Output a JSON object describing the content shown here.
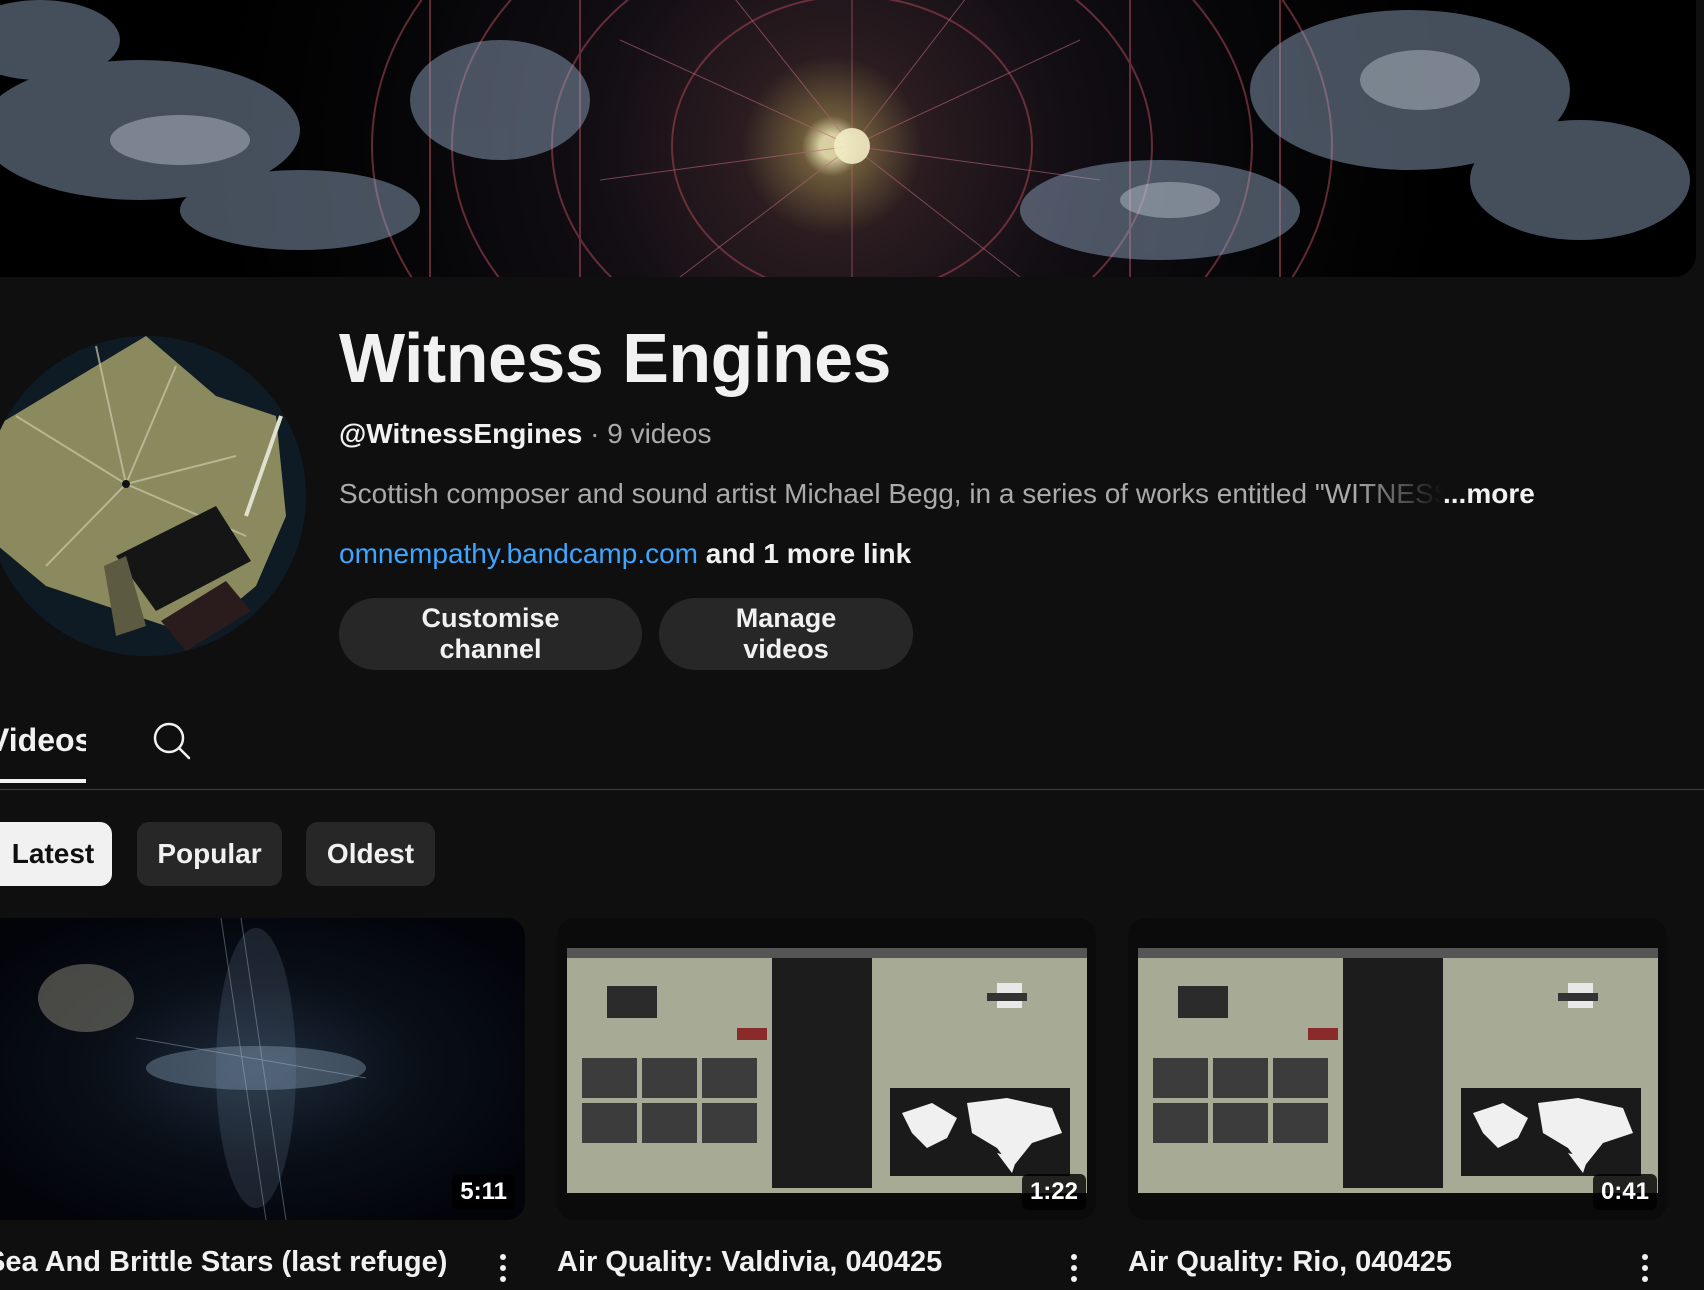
{
  "channel": {
    "name": "Witness Engines",
    "handle": "@WitnessEngines",
    "separator": " · ",
    "video_count": "9 videos",
    "description": "Scottish composer and sound artist Michael Begg, in a series of works entitled \"WITNESS ENGINES\"",
    "more_label": "...more",
    "link_url": "omnempathy.bandcamp.com",
    "more_links": " and 1 more link"
  },
  "actions": {
    "customise_label": "Customise channel",
    "manage_label": "Manage videos"
  },
  "tabs": {
    "videos_label": "Videos",
    "search_icon": "search-icon"
  },
  "sort_chips": {
    "latest": "Latest",
    "popular": "Popular",
    "oldest": "Oldest",
    "selected": "Latest"
  },
  "videos": [
    {
      "title": "Sea And Brittle Stars (last refuge)",
      "duration": "5:11"
    },
    {
      "title": "Air Quality: Valdivia, 040425",
      "duration": "1:22"
    },
    {
      "title": "Air Quality: Rio, 040425",
      "duration": "0:41"
    }
  ],
  "colors": {
    "background": "#0f0f0f",
    "link": "#3ea6ff",
    "chip_bg": "#272727",
    "chip_selected_bg": "#f1f1f1",
    "secondary_text": "#aaaaaa"
  }
}
